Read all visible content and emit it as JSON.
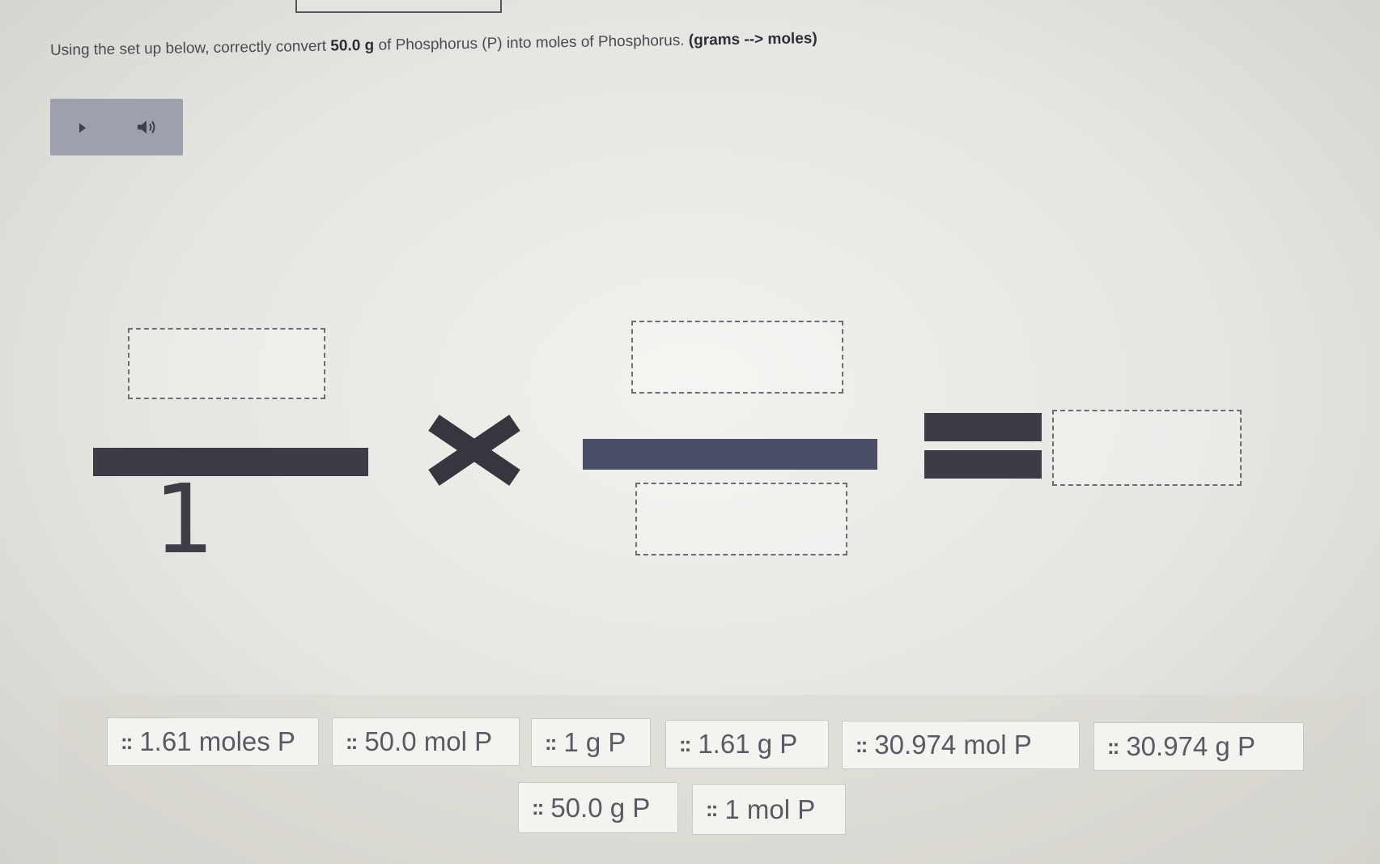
{
  "question": {
    "prefix": "Using the set up below, correctly convert ",
    "amount": "50.0 g",
    "middle": " of Phosphorus (P) into moles of Phosphorus. ",
    "direction": "(grams --> moles)"
  },
  "audio_player": {
    "play_icon": "play-icon",
    "volume_icon": "volume-icon"
  },
  "equation": {
    "first_denominator": "1",
    "operator_icon": "times-icon",
    "equals_icon": "equals-icon"
  },
  "answer_tiles": [
    {
      "grip": "::",
      "label": "1.61 moles P"
    },
    {
      "grip": "::",
      "label": "50.0 mol P"
    },
    {
      "grip": "::",
      "label": "1 g P"
    },
    {
      "grip": "::",
      "label": "1.61 g P"
    },
    {
      "grip": "::",
      "label": "30.974 mol P"
    },
    {
      "grip": "::",
      "label": "30.974 g P"
    },
    {
      "grip": "::",
      "label": "50.0 g P"
    },
    {
      "grip": "::",
      "label": "1 mol P"
    }
  ]
}
